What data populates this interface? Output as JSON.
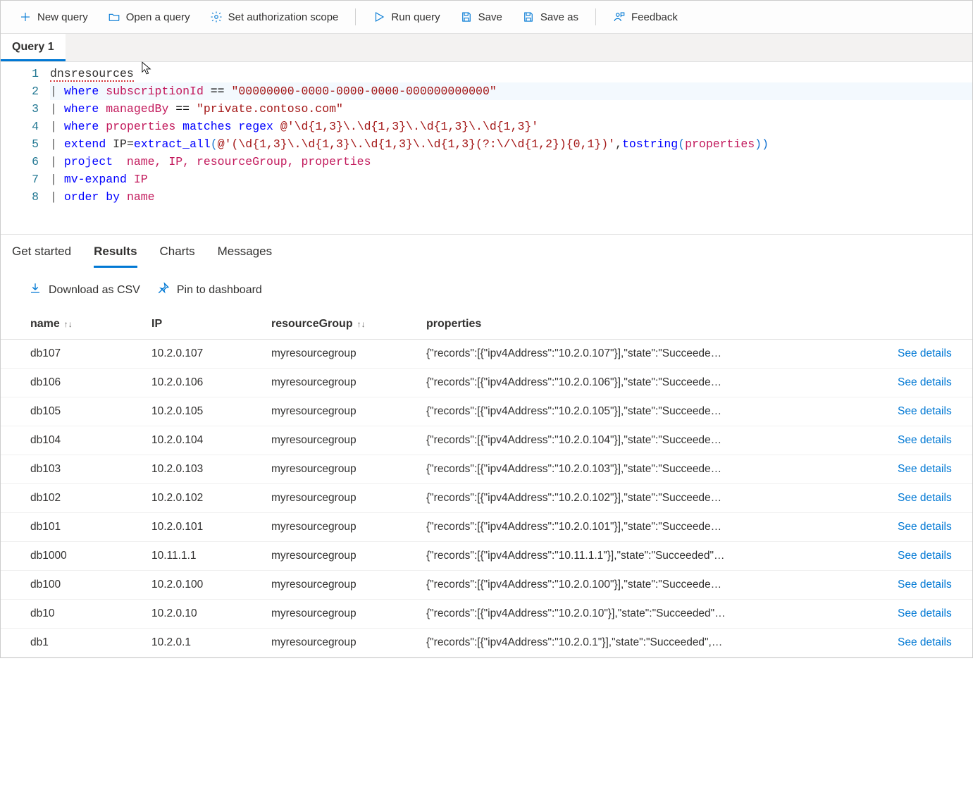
{
  "toolbar": {
    "new_query": "New query",
    "open_query": "Open a query",
    "auth_scope": "Set authorization scope",
    "run_query": "Run query",
    "save": "Save",
    "save_as": "Save as",
    "feedback": "Feedback"
  },
  "tabs": {
    "query1": "Query 1"
  },
  "editor": {
    "lines": [
      1,
      2,
      3,
      4,
      5,
      6,
      7,
      8
    ],
    "l1": {
      "a": "dnsresources"
    },
    "l2": {
      "pipe": "|",
      "kw": "where",
      "col": "subscriptionId",
      "op": "==",
      "str": "\"00000000-0000-0000-0000-000000000000\""
    },
    "l3": {
      "pipe": "|",
      "kw": "where",
      "col": "managedBy",
      "op": "==",
      "str": "\"private.contoso.com\""
    },
    "l4": {
      "pipe": "|",
      "kw": "where",
      "col": "properties",
      "op": "matches regex",
      "str": "@'\\d{1,3}\\.\\d{1,3}\\.\\d{1,3}\\.\\d{1,3}'"
    },
    "l5": {
      "pipe": "|",
      "kw": "extend",
      "assign": "IP=",
      "fn": "extract_all",
      "lp": "(",
      "str": "@'(\\d{1,3}\\.\\d{1,3}\\.\\d{1,3}\\.\\d{1,3}(?:\\/\\d{1,2}){0,1})'",
      "comma": ",",
      "fn2": "tostring",
      "lp2": "(",
      "col": "properties",
      "rp2": ")",
      "rp": ")"
    },
    "l6": {
      "pipe": "|",
      "kw": "project",
      "cols": "  name, IP, resourceGroup, properties"
    },
    "l7": {
      "pipe": "|",
      "kw": "mv-expand",
      "col": "IP"
    },
    "l8": {
      "pipe": "|",
      "kw": "order",
      "kw2": "by",
      "col": "name"
    }
  },
  "result_tabs": {
    "get_started": "Get started",
    "results": "Results",
    "charts": "Charts",
    "messages": "Messages"
  },
  "result_actions": {
    "download": "Download as CSV",
    "pin": "Pin to dashboard"
  },
  "table": {
    "headers": {
      "name": "name",
      "ip": "IP",
      "rg": "resourceGroup",
      "props": "properties"
    },
    "sort_glyph": "↑↓",
    "see_details": "See details",
    "rows": [
      {
        "name": "db107",
        "ip": "10.2.0.107",
        "rg": "myresourcegroup",
        "props": "{\"records\":[{\"ipv4Address\":\"10.2.0.107\"}],\"state\":\"Succeede…"
      },
      {
        "name": "db106",
        "ip": "10.2.0.106",
        "rg": "myresourcegroup",
        "props": "{\"records\":[{\"ipv4Address\":\"10.2.0.106\"}],\"state\":\"Succeede…"
      },
      {
        "name": "db105",
        "ip": "10.2.0.105",
        "rg": "myresourcegroup",
        "props": "{\"records\":[{\"ipv4Address\":\"10.2.0.105\"}],\"state\":\"Succeede…"
      },
      {
        "name": "db104",
        "ip": "10.2.0.104",
        "rg": "myresourcegroup",
        "props": "{\"records\":[{\"ipv4Address\":\"10.2.0.104\"}],\"state\":\"Succeede…"
      },
      {
        "name": "db103",
        "ip": "10.2.0.103",
        "rg": "myresourcegroup",
        "props": "{\"records\":[{\"ipv4Address\":\"10.2.0.103\"}],\"state\":\"Succeede…"
      },
      {
        "name": "db102",
        "ip": "10.2.0.102",
        "rg": "myresourcegroup",
        "props": "{\"records\":[{\"ipv4Address\":\"10.2.0.102\"}],\"state\":\"Succeede…"
      },
      {
        "name": "db101",
        "ip": "10.2.0.101",
        "rg": "myresourcegroup",
        "props": "{\"records\":[{\"ipv4Address\":\"10.2.0.101\"}],\"state\":\"Succeede…"
      },
      {
        "name": "db1000",
        "ip": "10.11.1.1",
        "rg": "myresourcegroup",
        "props": "{\"records\":[{\"ipv4Address\":\"10.11.1.1\"}],\"state\":\"Succeeded\"…"
      },
      {
        "name": "db100",
        "ip": "10.2.0.100",
        "rg": "myresourcegroup",
        "props": "{\"records\":[{\"ipv4Address\":\"10.2.0.100\"}],\"state\":\"Succeede…"
      },
      {
        "name": "db10",
        "ip": "10.2.0.10",
        "rg": "myresourcegroup",
        "props": "{\"records\":[{\"ipv4Address\":\"10.2.0.10\"}],\"state\":\"Succeeded\"…"
      },
      {
        "name": "db1",
        "ip": "10.2.0.1",
        "rg": "myresourcegroup",
        "props": "{\"records\":[{\"ipv4Address\":\"10.2.0.1\"}],\"state\":\"Succeeded\",…"
      }
    ]
  }
}
